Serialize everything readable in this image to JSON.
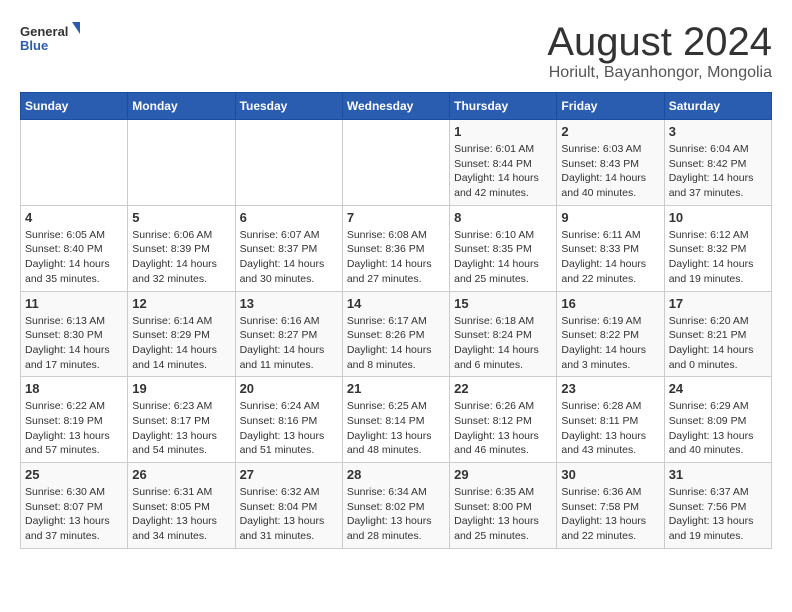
{
  "logo": {
    "general": "General",
    "blue": "Blue"
  },
  "header": {
    "month": "August 2024",
    "location": "Horiult, Bayanhongor, Mongolia"
  },
  "weekdays": [
    "Sunday",
    "Monday",
    "Tuesday",
    "Wednesday",
    "Thursday",
    "Friday",
    "Saturday"
  ],
  "weeks": [
    [
      {
        "day": "",
        "info": ""
      },
      {
        "day": "",
        "info": ""
      },
      {
        "day": "",
        "info": ""
      },
      {
        "day": "",
        "info": ""
      },
      {
        "day": "1",
        "info": "Sunrise: 6:01 AM\nSunset: 8:44 PM\nDaylight: 14 hours and 42 minutes."
      },
      {
        "day": "2",
        "info": "Sunrise: 6:03 AM\nSunset: 8:43 PM\nDaylight: 14 hours and 40 minutes."
      },
      {
        "day": "3",
        "info": "Sunrise: 6:04 AM\nSunset: 8:42 PM\nDaylight: 14 hours and 37 minutes."
      }
    ],
    [
      {
        "day": "4",
        "info": "Sunrise: 6:05 AM\nSunset: 8:40 PM\nDaylight: 14 hours and 35 minutes."
      },
      {
        "day": "5",
        "info": "Sunrise: 6:06 AM\nSunset: 8:39 PM\nDaylight: 14 hours and 32 minutes."
      },
      {
        "day": "6",
        "info": "Sunrise: 6:07 AM\nSunset: 8:37 PM\nDaylight: 14 hours and 30 minutes."
      },
      {
        "day": "7",
        "info": "Sunrise: 6:08 AM\nSunset: 8:36 PM\nDaylight: 14 hours and 27 minutes."
      },
      {
        "day": "8",
        "info": "Sunrise: 6:10 AM\nSunset: 8:35 PM\nDaylight: 14 hours and 25 minutes."
      },
      {
        "day": "9",
        "info": "Sunrise: 6:11 AM\nSunset: 8:33 PM\nDaylight: 14 hours and 22 minutes."
      },
      {
        "day": "10",
        "info": "Sunrise: 6:12 AM\nSunset: 8:32 PM\nDaylight: 14 hours and 19 minutes."
      }
    ],
    [
      {
        "day": "11",
        "info": "Sunrise: 6:13 AM\nSunset: 8:30 PM\nDaylight: 14 hours and 17 minutes."
      },
      {
        "day": "12",
        "info": "Sunrise: 6:14 AM\nSunset: 8:29 PM\nDaylight: 14 hours and 14 minutes."
      },
      {
        "day": "13",
        "info": "Sunrise: 6:16 AM\nSunset: 8:27 PM\nDaylight: 14 hours and 11 minutes."
      },
      {
        "day": "14",
        "info": "Sunrise: 6:17 AM\nSunset: 8:26 PM\nDaylight: 14 hours and 8 minutes."
      },
      {
        "day": "15",
        "info": "Sunrise: 6:18 AM\nSunset: 8:24 PM\nDaylight: 14 hours and 6 minutes."
      },
      {
        "day": "16",
        "info": "Sunrise: 6:19 AM\nSunset: 8:22 PM\nDaylight: 14 hours and 3 minutes."
      },
      {
        "day": "17",
        "info": "Sunrise: 6:20 AM\nSunset: 8:21 PM\nDaylight: 14 hours and 0 minutes."
      }
    ],
    [
      {
        "day": "18",
        "info": "Sunrise: 6:22 AM\nSunset: 8:19 PM\nDaylight: 13 hours and 57 minutes."
      },
      {
        "day": "19",
        "info": "Sunrise: 6:23 AM\nSunset: 8:17 PM\nDaylight: 13 hours and 54 minutes."
      },
      {
        "day": "20",
        "info": "Sunrise: 6:24 AM\nSunset: 8:16 PM\nDaylight: 13 hours and 51 minutes."
      },
      {
        "day": "21",
        "info": "Sunrise: 6:25 AM\nSunset: 8:14 PM\nDaylight: 13 hours and 48 minutes."
      },
      {
        "day": "22",
        "info": "Sunrise: 6:26 AM\nSunset: 8:12 PM\nDaylight: 13 hours and 46 minutes."
      },
      {
        "day": "23",
        "info": "Sunrise: 6:28 AM\nSunset: 8:11 PM\nDaylight: 13 hours and 43 minutes."
      },
      {
        "day": "24",
        "info": "Sunrise: 6:29 AM\nSunset: 8:09 PM\nDaylight: 13 hours and 40 minutes."
      }
    ],
    [
      {
        "day": "25",
        "info": "Sunrise: 6:30 AM\nSunset: 8:07 PM\nDaylight: 13 hours and 37 minutes."
      },
      {
        "day": "26",
        "info": "Sunrise: 6:31 AM\nSunset: 8:05 PM\nDaylight: 13 hours and 34 minutes."
      },
      {
        "day": "27",
        "info": "Sunrise: 6:32 AM\nSunset: 8:04 PM\nDaylight: 13 hours and 31 minutes."
      },
      {
        "day": "28",
        "info": "Sunrise: 6:34 AM\nSunset: 8:02 PM\nDaylight: 13 hours and 28 minutes."
      },
      {
        "day": "29",
        "info": "Sunrise: 6:35 AM\nSunset: 8:00 PM\nDaylight: 13 hours and 25 minutes."
      },
      {
        "day": "30",
        "info": "Sunrise: 6:36 AM\nSunset: 7:58 PM\nDaylight: 13 hours and 22 minutes."
      },
      {
        "day": "31",
        "info": "Sunrise: 6:37 AM\nSunset: 7:56 PM\nDaylight: 13 hours and 19 minutes."
      }
    ]
  ]
}
